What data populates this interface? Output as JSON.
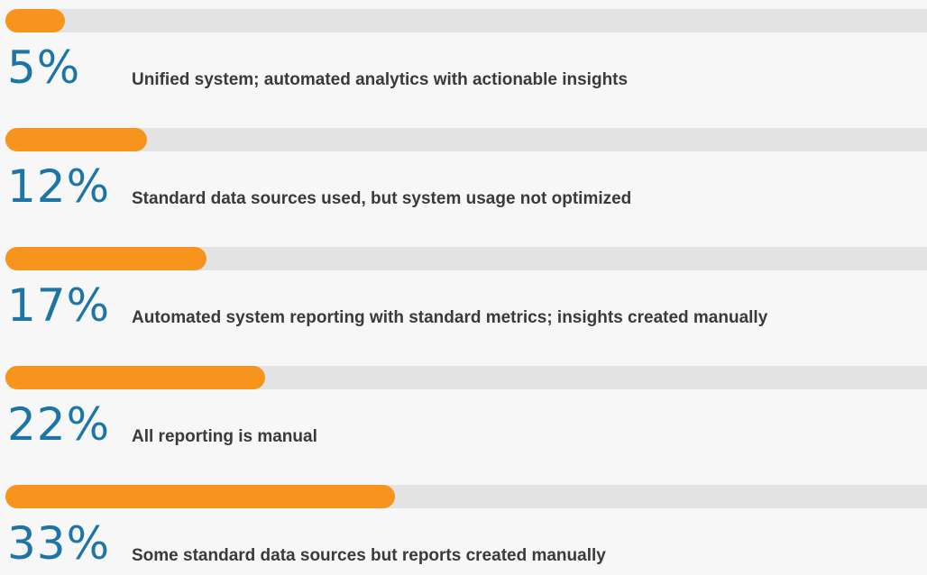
{
  "colors": {
    "bar_fill": "#f7941d",
    "bar_track": "#e3e3e3",
    "percent_text": "#1d75a6",
    "label_text": "#3a3a3a",
    "background": "#f7f7f7"
  },
  "chart_data": {
    "type": "bar",
    "orientation": "horizontal",
    "xlim": [
      0,
      100
    ],
    "grid": false,
    "rows": [
      {
        "percent_label": "5%",
        "value": 5,
        "description": "Unified system; automated analytics with actionable insights"
      },
      {
        "percent_label": "12%",
        "value": 12,
        "description": "Standard data sources used, but system usage not optimized"
      },
      {
        "percent_label": "17%",
        "value": 17,
        "description": "Automated system reporting with standard metrics; insights created manually"
      },
      {
        "percent_label": "22%",
        "value": 22,
        "description": "All reporting is manual"
      },
      {
        "percent_label": "33%",
        "value": 33,
        "description": "Some standard data sources but reports created manually"
      }
    ]
  }
}
